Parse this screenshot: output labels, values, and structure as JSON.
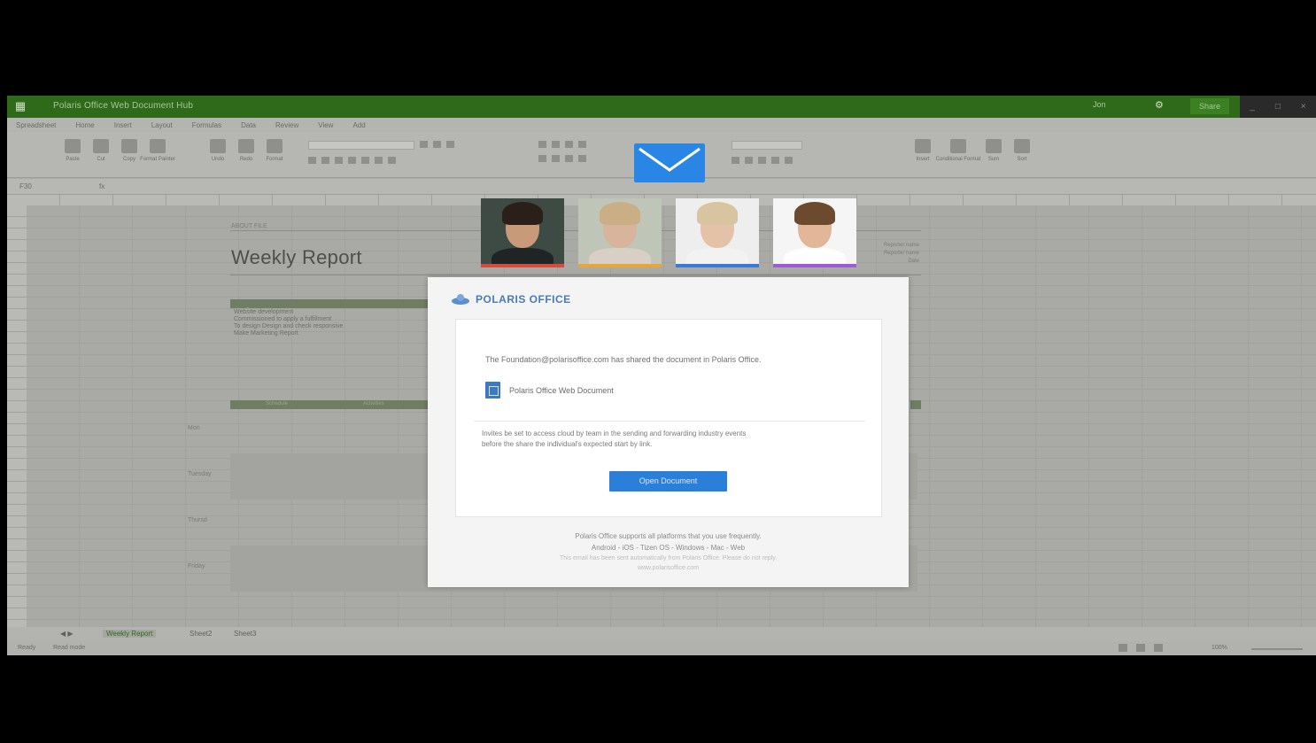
{
  "titlebar": {
    "title": "Polaris Office Web Document Hub",
    "user": "Jon",
    "share_label": "Share",
    "window_controls": [
      "_",
      "□",
      "×"
    ]
  },
  "menubar": {
    "items": [
      "Spreadsheet",
      "Home",
      "Insert",
      "Layout",
      "Formulas",
      "Data",
      "Review",
      "View",
      "Add"
    ]
  },
  "ribbon": {
    "buttons": [
      "Paste",
      "Cut",
      "Copy",
      "Format Painter",
      "Undo",
      "Redo",
      "Format",
      "Font",
      "Fill",
      "Border",
      "Merge",
      "Wrap",
      "Insert",
      "Conditional Format",
      "Sum",
      "Sort"
    ]
  },
  "formula": {
    "cellref": "F30",
    "fx": "fx"
  },
  "sheet": {
    "subtitle": "ABOUT FILE",
    "title": "Weekly Report",
    "right_labels": [
      "Reporter name",
      "Reporter name",
      "Date"
    ],
    "task_header": "Key Tasks of the week",
    "tasks": [
      "Website development",
      "Commissioned to apply a fulfillment",
      "To design Design and check responsive",
      "Make Marketing Report"
    ],
    "table_headers": [
      "Schedule",
      "Activities"
    ],
    "days": [
      "Mon",
      "Tuesday",
      "Thursd",
      "Friday"
    ]
  },
  "sheettabs": {
    "tabs": [
      "Weekly Report",
      "Sheet2",
      "Sheet3"
    ],
    "nav": "◀ ▶"
  },
  "status": {
    "left": "Ready",
    "mode": "Read mode",
    "zoom": "100%"
  },
  "overlay": {
    "avatars": [
      {
        "name": "person-1",
        "stripe": "#d64b3a",
        "skin": "#c99a7a",
        "hair": "#2b2019",
        "bg": "#3e4a44",
        "body": "#1f2527"
      },
      {
        "name": "person-2",
        "stripe": "#e8a63a",
        "skin": "#d8b49c",
        "hair": "#c9ae86",
        "bg": "#bfc6b8",
        "body": "#d8d0c4"
      },
      {
        "name": "person-3",
        "stripe": "#3a7ad6",
        "skin": "#e4c2a8",
        "hair": "#d8c4a0",
        "bg": "#eeeeee",
        "body": "#f2f2f2"
      },
      {
        "name": "person-4",
        "stripe": "#a05ad6",
        "skin": "#e2b698",
        "hair": "#6b4a2e",
        "bg": "#f5f5f5",
        "body": "#ffffff"
      }
    ],
    "mail_color": "#2a86e4"
  },
  "dialog": {
    "brand": "POLARIS OFFICE",
    "message": "The Foundation@polarisoffice.com has shared the document in Polaris Office.",
    "document_name": "Polaris Office Web Document",
    "note_line1": "Invites be set to access cloud by team in the sending and forwarding industry events",
    "note_line2": "before the share the individual's expected start by link.",
    "button_label": "Open Document",
    "footer_line1": "Polaris Office supports all platforms that you use frequently.",
    "footer_line2": "Android - iOS - Tizen OS - Windows - Mac - Web",
    "footer_line3": "This email has been sent automatically from Polaris Office. Please do not reply.",
    "footer_line4": "www.polarisoffice.com"
  }
}
